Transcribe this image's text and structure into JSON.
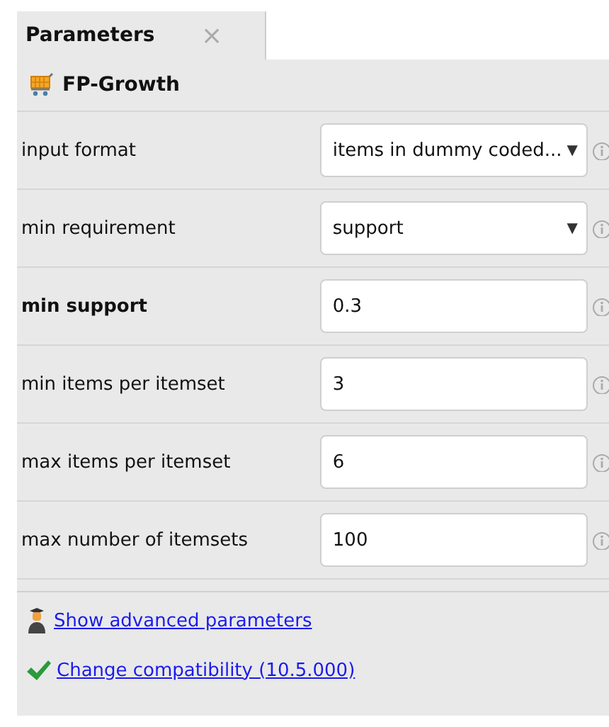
{
  "tab": {
    "title": "Parameters",
    "close": "×"
  },
  "operator": {
    "name": "FP-Growth"
  },
  "parameters": [
    {
      "label": "input format",
      "emphasized": false,
      "kind": "dropdown",
      "value": "items in dummy coded...",
      "arrow": "▼"
    },
    {
      "label": "min requirement",
      "emphasized": false,
      "kind": "dropdown",
      "value": "support",
      "arrow": "▼"
    },
    {
      "label": "min support",
      "emphasized": true,
      "kind": "text",
      "value": "0.3"
    },
    {
      "label": "min items per itemset",
      "emphasized": false,
      "kind": "text",
      "value": "3"
    },
    {
      "label": "max items per itemset",
      "emphasized": false,
      "kind": "text",
      "value": "6"
    },
    {
      "label": "max number of itemsets",
      "emphasized": false,
      "kind": "text",
      "value": "100"
    }
  ],
  "links": [
    {
      "kind": "advanced",
      "text": "Show advanced parameters"
    },
    {
      "kind": "compat",
      "text": "Change compatibility (10.5.000)"
    }
  ]
}
